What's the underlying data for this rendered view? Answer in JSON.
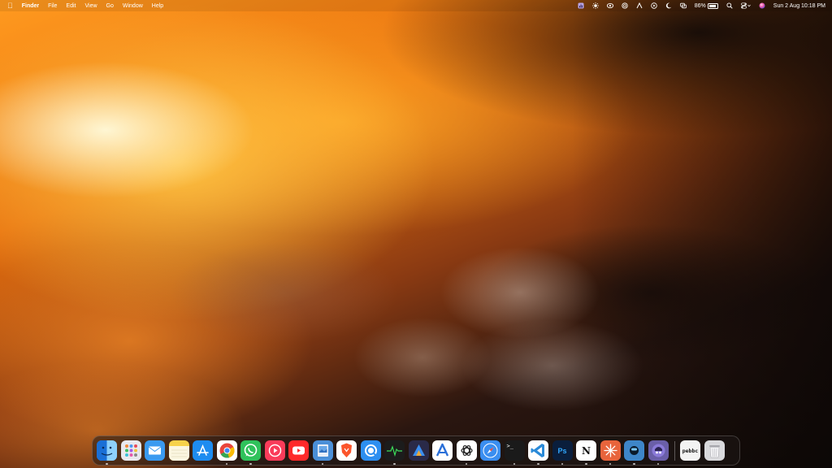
{
  "menubar": {
    "apple_icon": "apple-logo",
    "items": [
      "Finder",
      "File",
      "Edit",
      "View",
      "Go",
      "Window",
      "Help"
    ],
    "battery_percent": "86%",
    "battery_level": 0.86,
    "clock": "Sun 2 Aug  10:18 PM",
    "status_icons": [
      "stats-icon",
      "brightness-icon",
      "eye-icon",
      "openai-icon",
      "arc-icon",
      "play-icon",
      "moon-icon",
      "screen-mirror-icon",
      "battery-icon",
      "search-icon",
      "control-center-icon",
      "siri-icon"
    ]
  },
  "dock": {
    "apps": [
      {
        "name": "finder",
        "label": "",
        "bg": "#2f8fe8",
        "running": true
      },
      {
        "name": "launchpad",
        "label": "",
        "bg": "#e9e9ee",
        "running": false
      },
      {
        "name": "mail",
        "label": "",
        "bg": "#3a9af0",
        "running": false
      },
      {
        "name": "notes",
        "label": "",
        "bg": "#f7d24a",
        "running": false
      },
      {
        "name": "app-store",
        "label": "",
        "bg": "#1e8cf0",
        "running": false
      },
      {
        "name": "chrome",
        "label": "",
        "bg": "#ffffff",
        "running": true
      },
      {
        "name": "whatsapp",
        "label": "",
        "bg": "#2fc25b",
        "running": true
      },
      {
        "name": "music",
        "label": "",
        "bg": "#fa3c5a",
        "running": false
      },
      {
        "name": "youtube",
        "label": "",
        "bg": "#ff2a2a",
        "running": false
      },
      {
        "name": "preview",
        "label": "",
        "bg": "#4a8fd8",
        "running": true
      },
      {
        "name": "brave",
        "label": "",
        "bg": "#ffffff",
        "running": false
      },
      {
        "name": "qbittorrent",
        "label": "",
        "bg": "#2d8ff0",
        "running": false
      },
      {
        "name": "activity-monitor",
        "label": "",
        "bg": "#1c1c1c",
        "running": true
      },
      {
        "name": "affinity",
        "label": "",
        "bg": "#2a2a48",
        "running": false
      },
      {
        "name": "altstore",
        "label": "",
        "bg": "#ffffff",
        "running": false
      },
      {
        "name": "chatgpt",
        "label": "",
        "bg": "#ffffff",
        "running": true
      },
      {
        "name": "safari",
        "label": "",
        "bg": "#3a8ef0",
        "running": false
      },
      {
        "name": "terminal",
        "label": ">_",
        "bg": "#1a1a1a",
        "running": true
      },
      {
        "name": "vscode",
        "label": "",
        "bg": "#ffffff",
        "running": true
      },
      {
        "name": "photoshop",
        "label": "Ps",
        "bg": "#0a1e3c",
        "running": true
      },
      {
        "name": "notion",
        "label": "N",
        "bg": "#ffffff",
        "running": true
      },
      {
        "name": "claude",
        "label": "",
        "bg": "#e8643c",
        "running": true
      },
      {
        "name": "bartender",
        "label": "",
        "bg": "#3e86c8",
        "running": true
      },
      {
        "name": "alfred",
        "label": "",
        "bg": "#6a5fa8",
        "running": true
      }
    ],
    "extras": [
      {
        "name": "pebbc",
        "label": "pebbc",
        "bg": "#f3f3f3",
        "running": false
      },
      {
        "name": "trash",
        "label": "",
        "bg": "#d9d9dc",
        "running": false
      }
    ]
  }
}
